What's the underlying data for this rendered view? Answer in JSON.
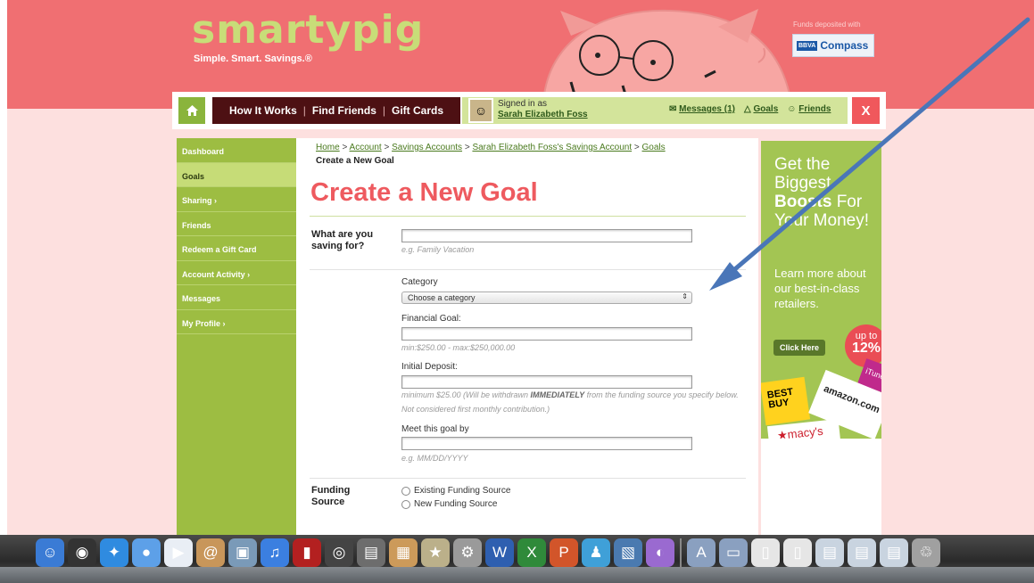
{
  "header": {
    "logo": "smartypig",
    "tagline": "Simple. Smart. Savings.®",
    "deposited_label": "Funds deposited with",
    "bank_badge": "BBVA",
    "bank_name": "Compass"
  },
  "nav": {
    "links": [
      "How It Works",
      "Find Friends",
      "Gift Cards"
    ],
    "signed_in_label": "Signed in as",
    "user_name": "Sarah Elizabeth Foss",
    "messages": "Messages (1)",
    "goals": "Goals",
    "friends": "Friends",
    "close": "X"
  },
  "sidebar": {
    "items": [
      {
        "label": "Dashboard"
      },
      {
        "label": "Goals"
      },
      {
        "label": "Sharing ›"
      },
      {
        "label": "Friends"
      },
      {
        "label": "Redeem a Gift Card"
      },
      {
        "label": "Account Activity ›"
      },
      {
        "label": "Messages"
      },
      {
        "label": "My Profile ›"
      }
    ]
  },
  "breadcrumb": {
    "home": "Home",
    "account": "Account",
    "savings": "Savings Accounts",
    "owner": "Sarah Elizabeth Foss's Savings Account",
    "goals": "Goals",
    "sep": ">",
    "current": "Create a New Goal"
  },
  "form": {
    "title": "Create a New Goal",
    "saving_for_label": "What are you saving for?",
    "saving_for_value": "",
    "saving_for_hint": "e.g. Family Vacation",
    "category_label": "Category",
    "category_selected": "Choose a category",
    "financial_goal_label": "Financial Goal:",
    "financial_goal_value": "",
    "financial_goal_hint": "min:$250.00 - max:$250,000.00",
    "initial_deposit_label": "Initial Deposit:",
    "initial_deposit_value": "",
    "initial_deposit_hint_a": "minimum $25.00 (Will be withdrawn ",
    "initial_deposit_hint_b": "IMMEDIATELY",
    "initial_deposit_hint_c": " from the funding source you specify below. Not considered first monthly contribution.)",
    "meet_goal_label": "Meet this goal by",
    "meet_goal_value": "",
    "meet_goal_hint": "e.g. MM/DD/YYYY",
    "funding_label": "Funding Source",
    "funding_options": [
      "Existing Funding Source",
      "New Funding Source"
    ]
  },
  "ad": {
    "headline_a": "Get the Biggest",
    "headline_b": "Boosts",
    "headline_c": "For Your Money!",
    "sub": "Learn more about our best-in-class retailers.",
    "button": "Click Here",
    "badge_a": "up to",
    "badge_b": "12%",
    "card_bestbuy": "BEST BUY",
    "card_amazon": "amazon.com",
    "card_itunes": "iTunes",
    "card_macys": "★macy's"
  },
  "dock": {
    "icons": [
      "finder-icon",
      "dashboard-icon",
      "safari-icon",
      "ichat-icon",
      "facetime-icon",
      "address-book-icon",
      "iphoto-icon",
      "itunes-icon",
      "photo-booth-icon",
      "aperture-icon",
      "imovie-icon",
      "preview-icon",
      "star-icon",
      "system-preferences-icon",
      "word-icon",
      "excel-icon",
      "powerpoint-icon",
      "messenger-icon",
      "photo-icon",
      "utility-icon",
      "applications-folder-icon",
      "documents-folder-icon",
      "file-icon",
      "file-icon",
      "window-icon",
      "window-icon",
      "window-icon",
      "trash-icon"
    ],
    "colors": [
      "#3a7bd5",
      "#333333",
      "#2f8be0",
      "#5da0e8",
      "#e9eef5",
      "#c8965a",
      "#7a9ab8",
      "#3b7fe0",
      "#b32020",
      "#444444",
      "#6d6d6d",
      "#cc9a5a",
      "#bbb08a",
      "#9a9a9a",
      "#2e5fb0",
      "#2f8a3a",
      "#d2552a",
      "#3fa0d8",
      "#4a7ab0",
      "#9a6ad0",
      "#8aa0c0",
      "#8aa0c0",
      "#e6e6e6",
      "#e6e6e6",
      "#c9d4e0",
      "#c9d4e0",
      "#c9d4e0",
      "#a0a0a0"
    ]
  },
  "colors": {
    "brand_pink": "#f06f72",
    "brand_green": "#9dbd42",
    "title_red": "#ee5a5f",
    "nav_dark": "#4d1013",
    "arrow_blue": "#4a76b8"
  }
}
